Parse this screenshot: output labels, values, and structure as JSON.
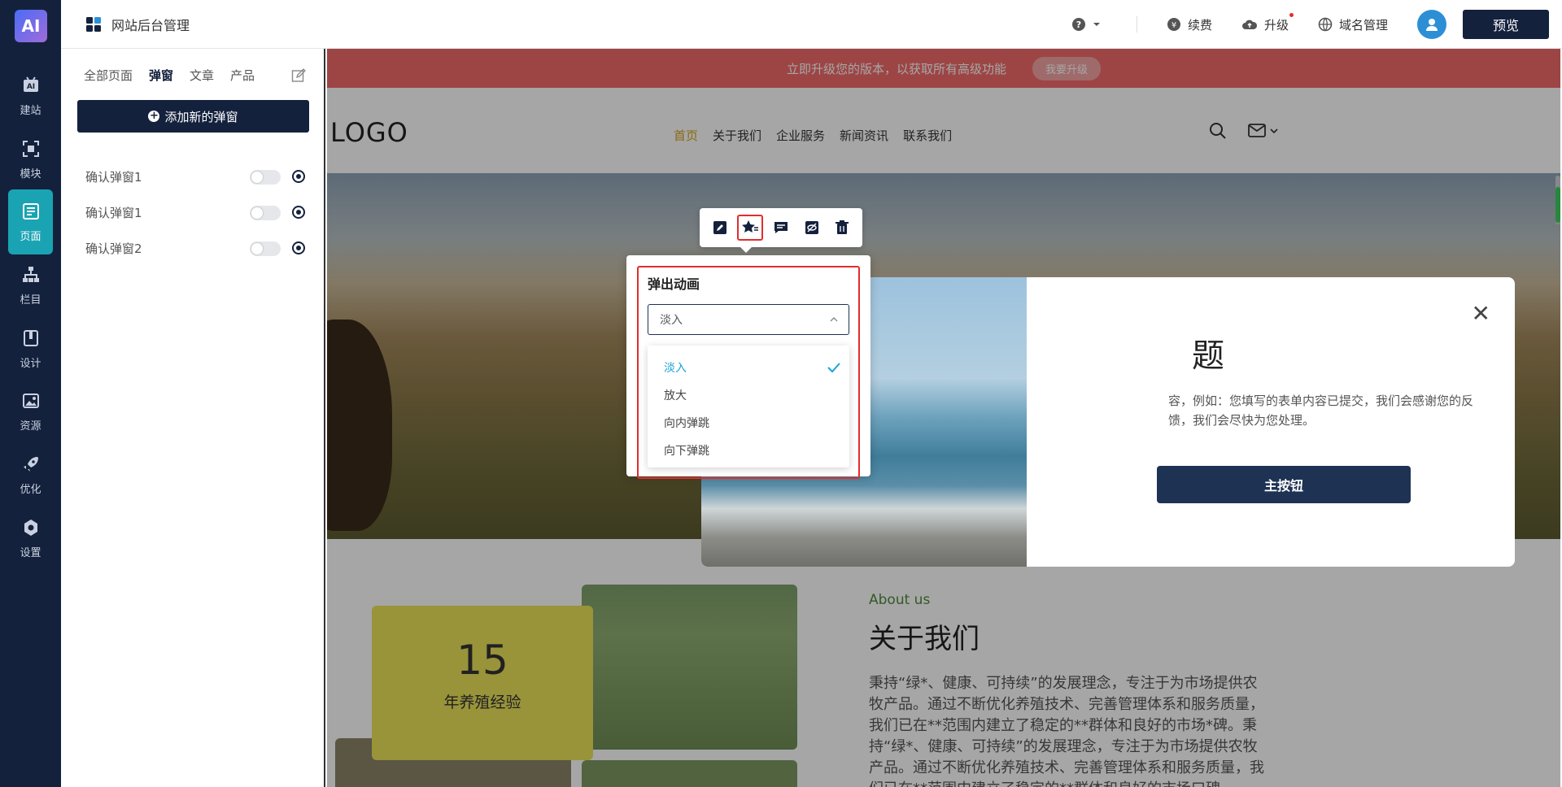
{
  "app": {
    "logo": "AI",
    "title": "网站后台管理"
  },
  "rail": [
    {
      "label": "建站",
      "icon": "ai-build-icon"
    },
    {
      "label": "模块",
      "icon": "module-icon"
    },
    {
      "label": "页面",
      "icon": "page-icon",
      "active": true
    },
    {
      "label": "栏目",
      "icon": "sitemap-icon"
    },
    {
      "label": "设计",
      "icon": "design-icon"
    },
    {
      "label": "资源",
      "icon": "image-icon"
    },
    {
      "label": "优化",
      "icon": "rocket-icon"
    },
    {
      "label": "设置",
      "icon": "gear-icon"
    }
  ],
  "topbar": {
    "help": "?",
    "renew": "续费",
    "upgrade": "升级",
    "domain": "域名管理",
    "preview": "预览"
  },
  "panel": {
    "tabs": [
      "全部页面",
      "弹窗",
      "文章",
      "产品"
    ],
    "active_tab": "弹窗",
    "add_button": "添加新的弹窗",
    "items": [
      {
        "label": "确认弹窗1"
      },
      {
        "label": "确认弹窗1"
      },
      {
        "label": "确认弹窗2"
      }
    ]
  },
  "site": {
    "promo_text": "立即升级您的版本，以获取所有高级功能",
    "promo_button": "我要升级",
    "logo": "LOGO",
    "nav": [
      "首页",
      "关于我们",
      "企业服务",
      "新闻资讯",
      "联系我们"
    ],
    "nav_active": "首页",
    "about": {
      "stat_number": "15",
      "stat_label": "年养殖经验",
      "en_title": "About us",
      "cn_title": "关于我们",
      "text": "秉持“绿*、健康、可持续”的发展理念，专注于为市场提供农牧产品。通过不断优化养殖技术、完善管理体系和服务质量，我们已在**范围内建立了稳定的**群体和良好的市场*碑。秉持“绿*、健康、可持续”的发展理念，专注于为市场提供农牧产品。通过不断优化养殖技术、完善管理体系和服务质量，我们已在**范围内建立了稳定的**群体和良好的市场口碑。"
    }
  },
  "modal": {
    "title": "题",
    "text": "容，例如：您填写的表单内容已提交，我们会感谢您的反馈，我们会尽快为您处理。",
    "primary_button": "主按钮",
    "close": "✕"
  },
  "toolbar": {
    "buttons": [
      "edit-icon",
      "star-animation-icon",
      "comment-icon",
      "hide-icon",
      "trash-icon"
    ],
    "highlighted": "star-animation-icon"
  },
  "animation": {
    "label": "弹出动画",
    "selected": "淡入",
    "options": [
      "淡入",
      "放大",
      "向内弹跳",
      "向下弹跳"
    ]
  },
  "colors": {
    "dark_navy": "#14213d",
    "teal_active": "#1aa3b3",
    "promo_red": "#f26b6b",
    "highlight_red": "#e22d2d",
    "nav_active": "#d4a017",
    "select_blue": "#1aa3d8"
  }
}
